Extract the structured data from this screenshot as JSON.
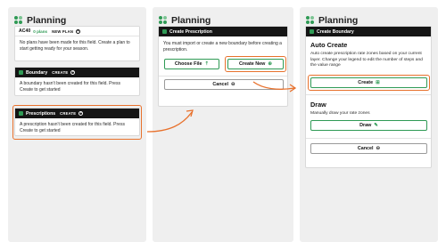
{
  "colors": {
    "accent": "#2f9a55",
    "highlight": "#e8712c",
    "dark": "#151515",
    "panel": "#efefef"
  },
  "panel1": {
    "title": "Planning",
    "ac40": {
      "name": "AC40",
      "plans": "0 plans",
      "new_plan": "NEW PLAN",
      "text": "No plans have been made for this field. Create a plan to start getting ready for your season."
    },
    "boundary": {
      "title": "Boundary",
      "create": "CREATE",
      "text": "A boundary hasn't been created for this field. Press Create to get started"
    },
    "prescriptions": {
      "title": "Prescriptions",
      "create": "CREATE",
      "text": "A prescription hasn't been created for this field. Press Create to get started"
    }
  },
  "panel2": {
    "title": "Planning",
    "card_title": "Create Prescription",
    "text": "You must import or create a new boundary before creating a prescription.",
    "choose_file": "Choose File",
    "create_new": "Create New",
    "cancel": "Cancel"
  },
  "panel3": {
    "title": "Planning",
    "card_title": "Create Boundary",
    "auto_title": "Auto Create",
    "auto_text": "Auto create prescription rate zones based on your current layer. Change your legend to edit the number of steps and the value range",
    "create": "Create",
    "draw_title": "Draw",
    "draw_text": "Manually draw your rate zones",
    "draw": "Draw",
    "cancel": "Cancel"
  }
}
